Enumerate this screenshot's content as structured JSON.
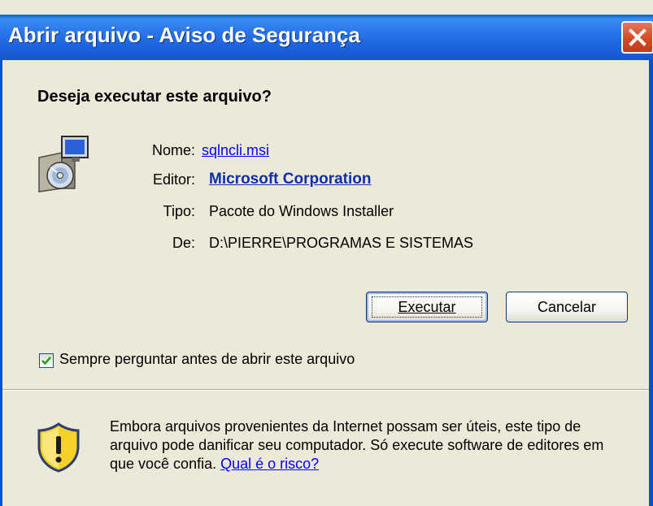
{
  "window": {
    "title": "Abrir arquivo - Aviso de Segurança"
  },
  "question": "Deseja executar este arquivo?",
  "file": {
    "icon": "installer-package-icon",
    "name_label": "Nome:",
    "name_value": "sqlncli.msi",
    "publisher_label": "Editor:",
    "publisher_value": "Microsoft Corporation",
    "type_label": "Tipo:",
    "type_value": "Pacote do Windows Installer",
    "from_label": "De:",
    "from_value": "D:\\PIERRE\\PROGRAMAS E SISTEMAS"
  },
  "buttons": {
    "run": "Executar",
    "cancel": "Cancelar"
  },
  "checkbox": {
    "label": "Sempre perguntar antes de abrir este arquivo",
    "checked": true
  },
  "warning": {
    "icon": "security-shield-icon",
    "text": "Embora arquivos provenientes da Internet possam ser úteis, este tipo de arquivo pode danificar seu computador. Só execute software de editores em que você confia.",
    "link": "Qual é o risco?"
  },
  "colors": {
    "titlebar": "#2a74ea",
    "link": "#0000ff",
    "dialog_bg": "#ece9d8",
    "close": "#d44a25"
  }
}
